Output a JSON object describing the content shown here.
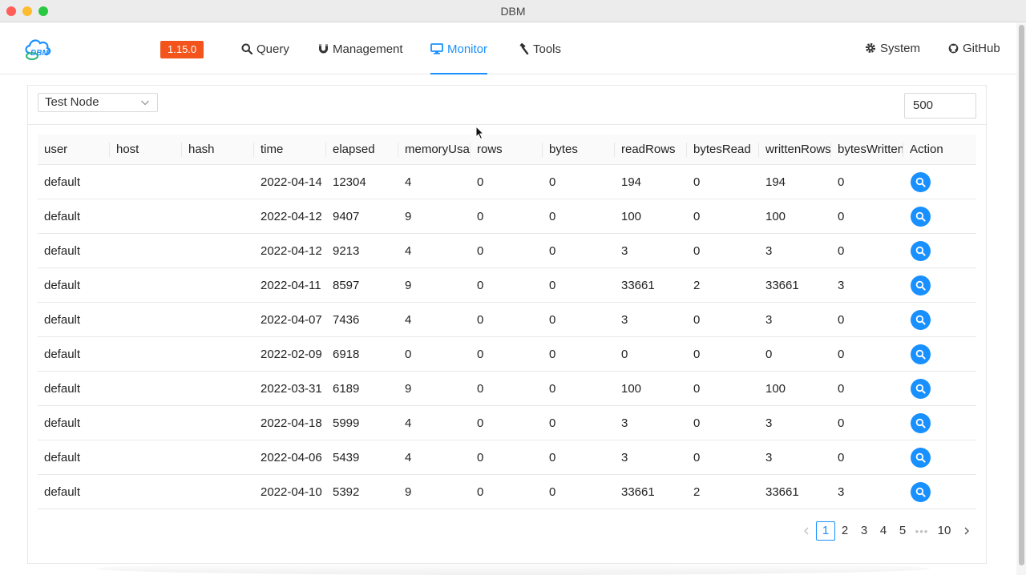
{
  "window": {
    "title": "DBM"
  },
  "header": {
    "version": "1.15.0",
    "nav": [
      {
        "label": "Query",
        "icon": "search-icon"
      },
      {
        "label": "Management",
        "icon": "magnet-icon"
      },
      {
        "label": "Monitor",
        "icon": "desktop-icon",
        "active": true
      },
      {
        "label": "Tools",
        "icon": "hammer-icon"
      }
    ],
    "right_nav": [
      {
        "label": "System",
        "icon": "gear-icon"
      },
      {
        "label": "GitHub",
        "icon": "github-icon"
      }
    ]
  },
  "toolbar": {
    "node_select": "Test Node",
    "limit_value": "500"
  },
  "table": {
    "columns": [
      "user",
      "host",
      "hash",
      "time",
      "elapsed",
      "memoryUsage",
      "rows",
      "bytes",
      "readRows",
      "bytesRead",
      "writtenRows",
      "bytesWritten",
      "Action"
    ],
    "rows": [
      [
        "default",
        "",
        "",
        "2022-04-14",
        "12304",
        "4",
        "0",
        "0",
        "194",
        "0",
        "194",
        "0"
      ],
      [
        "default",
        "",
        "",
        "2022-04-12",
        "9407",
        "9",
        "0",
        "0",
        "100",
        "0",
        "100",
        "0"
      ],
      [
        "default",
        "",
        "",
        "2022-04-12",
        "9213",
        "4",
        "0",
        "0",
        "3",
        "0",
        "3",
        "0"
      ],
      [
        "default",
        "",
        "",
        "2022-04-11",
        "8597",
        "9",
        "0",
        "0",
        "33661",
        "2",
        "33661",
        "3"
      ],
      [
        "default",
        "",
        "",
        "2022-04-07",
        "7436",
        "4",
        "0",
        "0",
        "3",
        "0",
        "3",
        "0"
      ],
      [
        "default",
        "",
        "",
        "2022-02-09",
        "6918",
        "0",
        "0",
        "0",
        "0",
        "0",
        "0",
        "0"
      ],
      [
        "default",
        "",
        "",
        "2022-03-31",
        "6189",
        "9",
        "0",
        "0",
        "100",
        "0",
        "100",
        "0"
      ],
      [
        "default",
        "",
        "",
        "2022-04-18",
        "5999",
        "4",
        "0",
        "0",
        "3",
        "0",
        "3",
        "0"
      ],
      [
        "default",
        "",
        "",
        "2022-04-06",
        "5439",
        "4",
        "0",
        "0",
        "3",
        "0",
        "3",
        "0"
      ],
      [
        "default",
        "",
        "",
        "2022-04-10",
        "5392",
        "9",
        "0",
        "0",
        "33661",
        "2",
        "33661",
        "3"
      ]
    ]
  },
  "pagination": {
    "pages": [
      "1",
      "2",
      "3",
      "4",
      "5"
    ],
    "current": "1",
    "ellipsis": "•••",
    "last": "10"
  },
  "colors": {
    "accent": "#1890ff",
    "version_badge": "#f2541b"
  }
}
